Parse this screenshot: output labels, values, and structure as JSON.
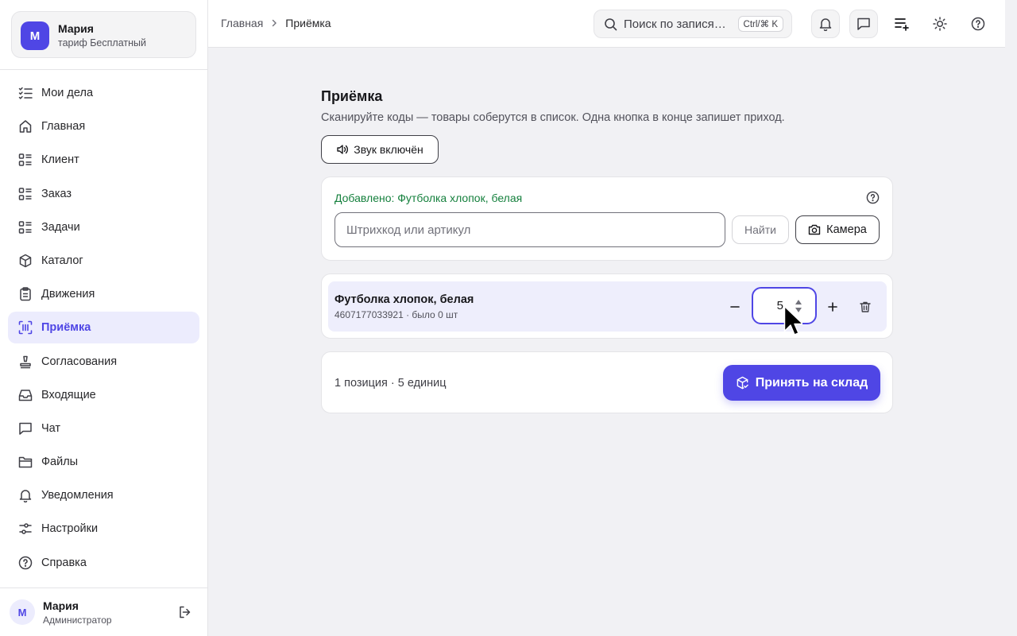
{
  "org": {
    "initial": "М",
    "name": "Мария",
    "plan": "тариф Бесплатный"
  },
  "sidebar": {
    "items": [
      {
        "label": "Мои дела",
        "icon": "checklist-icon"
      },
      {
        "label": "Главная",
        "icon": "home-icon"
      },
      {
        "label": "Клиент",
        "icon": "list-icon"
      },
      {
        "label": "Заказ",
        "icon": "list-icon"
      },
      {
        "label": "Задачи",
        "icon": "list-icon"
      },
      {
        "label": "Каталог",
        "icon": "box-icon"
      },
      {
        "label": "Движения",
        "icon": "clipboard-icon"
      },
      {
        "label": "Приёмка",
        "icon": "barcode-scan-icon",
        "active": true
      },
      {
        "label": "Согласования",
        "icon": "stamp-icon"
      },
      {
        "label": "Входящие",
        "icon": "inbox-icon"
      },
      {
        "label": "Чат",
        "icon": "chat-icon"
      },
      {
        "label": "Файлы",
        "icon": "folder-icon"
      },
      {
        "label": "Уведомления",
        "icon": "bell-icon"
      },
      {
        "label": "Настройки",
        "icon": "sliders-icon"
      },
      {
        "label": "Справка",
        "icon": "help-icon"
      }
    ]
  },
  "user": {
    "initial": "М",
    "name": "Мария",
    "role": "Администратор"
  },
  "topbar": {
    "breadcrumb": [
      "Главная",
      "Приёмка"
    ],
    "search_placeholder": "Поиск по записям…",
    "search_display": "Поиск по запися…",
    "shortcut": "Ctrl/⌘ K"
  },
  "page": {
    "title": "Приёмка",
    "subtitle": "Сканируйте коды — товары соберутся в список. Одна кнопка в конце запишет приход.",
    "sound_label": "Звук включён"
  },
  "scan": {
    "added_message": "Добавлено: Футболка хлопок, белая",
    "input_value": "",
    "input_placeholder": "Штрихкод или артикул",
    "find_label": "Найти",
    "camera_label": "Камера"
  },
  "items": [
    {
      "name": "Футболка хлопок, белая",
      "meta": "4607177033921 · было 0 шт",
      "quantity": "5"
    }
  ],
  "summary": {
    "text": "1 позиция · 5 единиц",
    "accept_label": "Принять на склад"
  },
  "colors": {
    "accent": "#4f46e5",
    "success": "#15803d",
    "active_bg": "#ececfd"
  }
}
